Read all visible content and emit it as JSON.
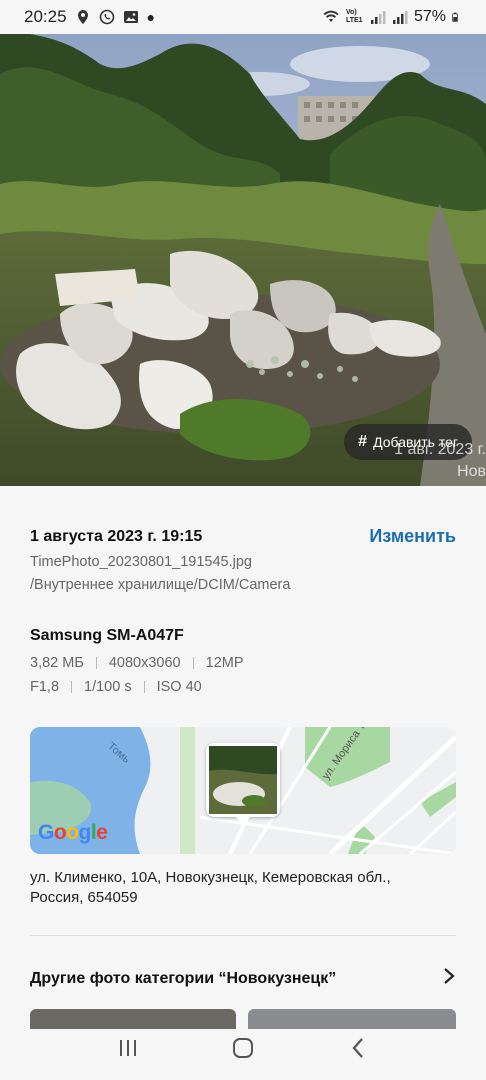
{
  "status_bar": {
    "time": "20:25",
    "network_label": "Vo) LTE1",
    "battery": "57%"
  },
  "photo": {
    "tag_button_label": "Добавить тег",
    "watermark_line1": "1 авг. 2023 г.",
    "watermark_line2": "Нов"
  },
  "details": {
    "date": "1 августа 2023 г. 19:15",
    "edit_label": "Изменить",
    "file_name": "TimePhoto_20230801_191545.jpg",
    "file_path": "/Внутреннее хранилище/DCIM/Camera",
    "device": "Samsung SM-A047F",
    "size": "3,82 МБ",
    "resolution": "4080x3060",
    "megapixels": "12MP",
    "aperture": "F1,8",
    "shutter": "1/100 s",
    "iso": "ISO 40"
  },
  "map": {
    "provider": "Google",
    "river_label": "Томь",
    "street_label": "ул. Мориса Тореза"
  },
  "address": "ул. Клименко, 10А, Новокузнецк, Кемеровская обл., Россия, 654059",
  "other_photos": {
    "title": "Другие фото категории “Новокузнецк”"
  },
  "colors": {
    "accent": "#1a6fb4",
    "background": "#f6f6f6"
  }
}
